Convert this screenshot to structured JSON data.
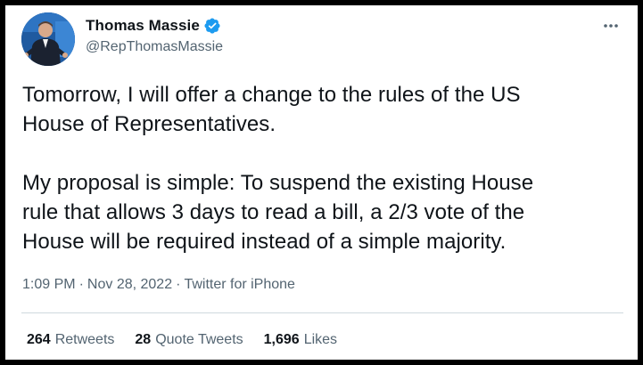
{
  "author": {
    "display_name": "Thomas Massie",
    "handle": "@RepThomasMassie",
    "verified": true
  },
  "tweet": {
    "text": "Tomorrow, I will offer a change to the rules of the US\nHouse of Representatives.\n\nMy proposal is simple: To suspend the existing House\nrule that allows 3 days to read a bill, a 2/3 vote of the\nHouse will be required instead of a simple majority.",
    "time": "1:09 PM",
    "date": "Nov 28, 2022",
    "separator": "·",
    "source": "Twitter for iPhone"
  },
  "stats": {
    "retweets_count": "264",
    "retweets_label": "Retweets",
    "quotes_count": "28",
    "quotes_label": "Quote Tweets",
    "likes_count": "1,696",
    "likes_label": "Likes"
  },
  "icons": {
    "verified": "verified-badge-icon",
    "more": "more-options-icon"
  },
  "colors": {
    "verified_blue": "#1d9bf0",
    "text_primary": "#0f1419",
    "text_secondary": "#536471",
    "divider": "#cfd9de",
    "frame": "#000000"
  }
}
